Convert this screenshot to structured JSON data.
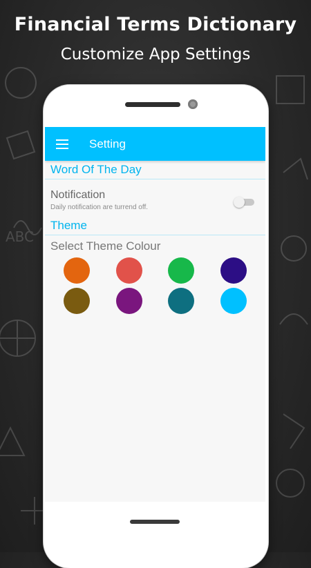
{
  "promo": {
    "title": "Financial Terms Dictionary",
    "subtitle": "Customize App Settings"
  },
  "appbar": {
    "title": "Setting",
    "menu_icon": "hamburger-menu-icon",
    "color": "#00C0FF"
  },
  "word_of_day": {
    "header": "Word Of The Day",
    "notification": {
      "title": "Notification",
      "summary": "Daily notification are turrend off.",
      "enabled": false
    }
  },
  "theme": {
    "header": "Theme",
    "select_label": "Select Theme Colour",
    "colors": [
      "#E3650F",
      "#E1524A",
      "#17B84A",
      "#2C0E85",
      "#7A5B10",
      "#7A167E",
      "#0E6F80",
      "#00C0FF"
    ]
  }
}
